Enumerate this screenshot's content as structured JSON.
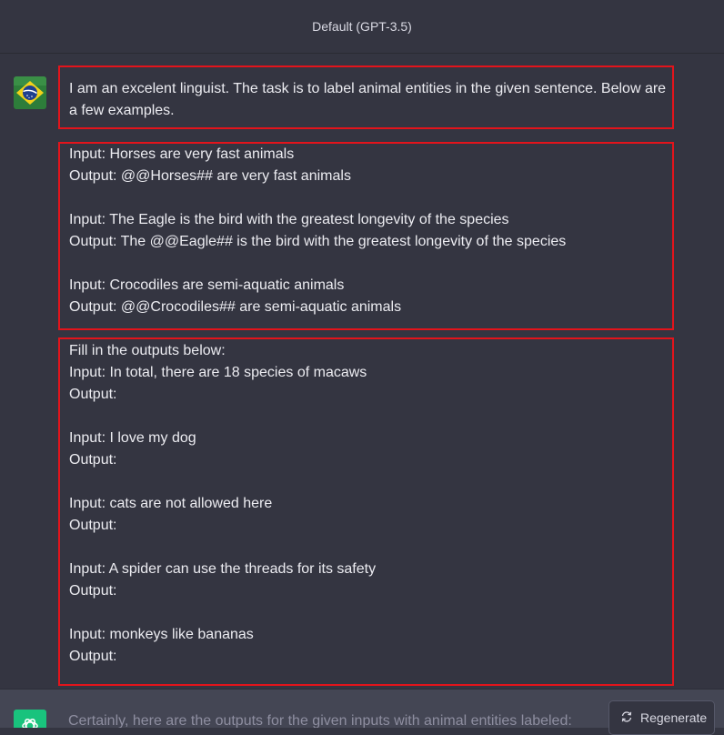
{
  "header": {
    "title": "Default (GPT-3.5)"
  },
  "user_message": {
    "avatar_icon": "brazil-flag-avatar",
    "intro": [
      "I am an excelent linguist. The task is to label animal entities in the given sentence. Below are",
      "a few examples."
    ],
    "examples": [
      "Input: Horses are very fast animals",
      "Output: @@Horses## are very fast animals",
      "",
      "Input: The Eagle is the bird with the greatest longevity of the species",
      "Output: The @@Eagle## is the bird with the greatest longevity of the species",
      "",
      "Input: Crocodiles are semi-aquatic animals",
      "Output: @@Crocodiles## are semi-aquatic animals"
    ],
    "task": [
      "Fill in the outputs below:",
      "Input: In total, there are 18 species of macaws",
      "Output:",
      "",
      "Input: I love my dog",
      "Output:",
      "",
      "Input: cats are not allowed here",
      "Output:",
      "",
      "Input: A spider can use the threads for its safety",
      "Output:",
      "",
      "Input: monkeys like bananas",
      "Output:"
    ]
  },
  "assistant_message": {
    "avatar_icon": "openai-logo-icon",
    "text": "Certainly, here are the outputs for the given inputs with animal entities labeled:"
  },
  "regenerate": {
    "label": "Regenerate",
    "icon": "refresh-icon"
  },
  "colors": {
    "background": "#343541",
    "assistant_bg": "#444654",
    "highlight_border": "#e3141b",
    "gpt_green": "#19c37d"
  }
}
